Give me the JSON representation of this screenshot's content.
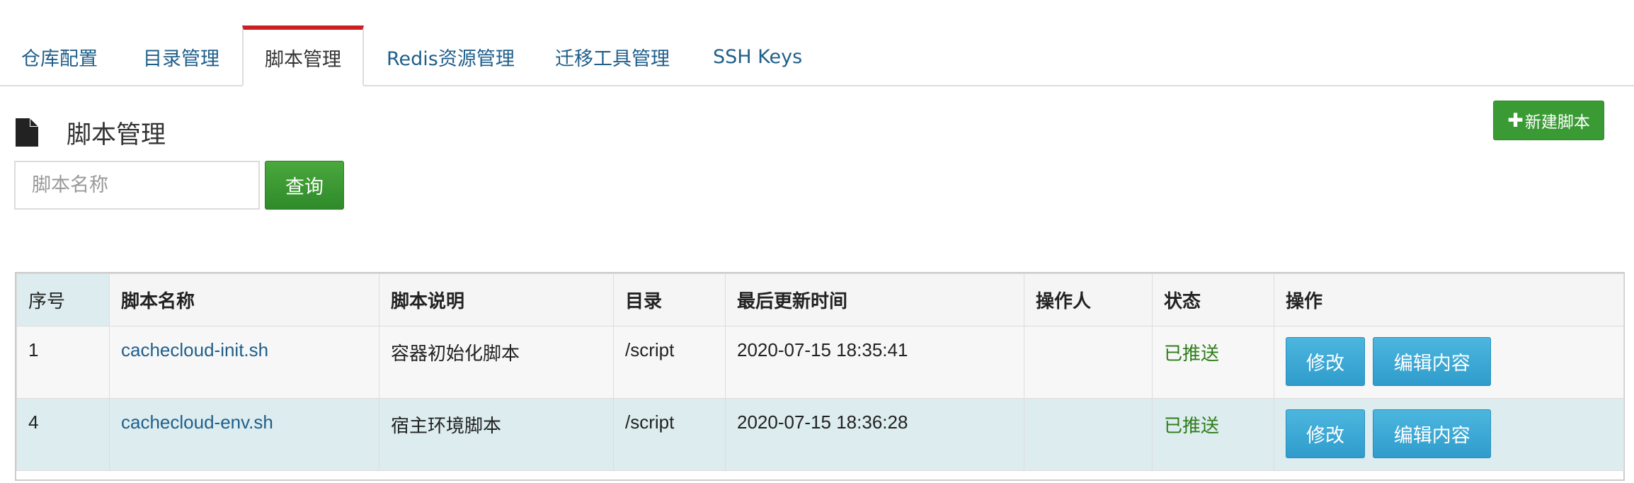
{
  "tabs": [
    {
      "label": "仓库配置",
      "active": false
    },
    {
      "label": "目录管理",
      "active": false
    },
    {
      "label": "脚本管理",
      "active": true
    },
    {
      "label": "Redis资源管理",
      "active": false
    },
    {
      "label": "迁移工具管理",
      "active": false
    },
    {
      "label": "SSH Keys",
      "active": false
    }
  ],
  "header": {
    "title": "脚本管理",
    "icon": "file-icon",
    "new_button_label": "新建脚本",
    "new_button_icon": "plus-icon"
  },
  "search": {
    "placeholder": "脚本名称",
    "value": "",
    "button_label": "查询"
  },
  "table": {
    "columns": [
      "序号",
      "脚本名称",
      "脚本说明",
      "目录",
      "最后更新时间",
      "操作人",
      "状态",
      "操作"
    ],
    "rows": [
      {
        "seq": "1",
        "name": "cachecloud-init.sh",
        "desc": "容器初始化脚本",
        "dir": "/script",
        "updated": "2020-07-15 18:35:41",
        "operator": "",
        "status": "已推送",
        "edit_label": "修改",
        "content_label": "编辑内容"
      },
      {
        "seq": "4",
        "name": "cachecloud-env.sh",
        "desc": "宿主环境脚本",
        "dir": "/script",
        "updated": "2020-07-15 18:36:28",
        "operator": "",
        "status": "已推送",
        "edit_label": "修改",
        "content_label": "编辑内容"
      }
    ]
  },
  "colors": {
    "tab_active_accent": "#cc1f1f",
    "link": "#1f5f8b",
    "green_button": "#3a9a33",
    "blue_button": "#2f9ccc",
    "status_green": "#2f7d1a",
    "row_highlight": "#dcecef"
  }
}
